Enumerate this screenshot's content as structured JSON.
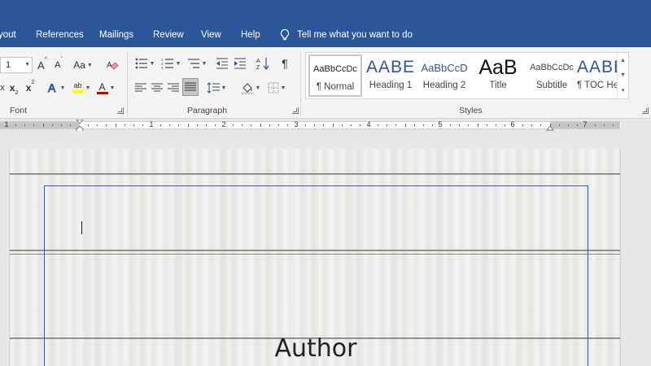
{
  "ribbon_tabs": [
    "yout",
    "References",
    "Mailings",
    "Review",
    "View",
    "Help"
  ],
  "tell_me": {
    "icon": "lightbulb-icon",
    "label": "Tell me what you want to do"
  },
  "font_group": {
    "label": "Font",
    "size_value": "1",
    "grow_label": "A",
    "shrink_label": "A",
    "case_label": "Aa",
    "subscript_label": "x",
    "superscript_label": "x",
    "highlight_label": "ab",
    "font_color_label": "A"
  },
  "paragraph_group": {
    "label": "Paragraph",
    "pilcrow": "¶"
  },
  "styles_group": {
    "label": "Styles",
    "items": [
      {
        "preview": "AaBbCcDc",
        "name": "¶ Normal"
      },
      {
        "preview": "AABE",
        "name": "Heading 1"
      },
      {
        "preview": "AaBbCcD",
        "name": "Heading 2"
      },
      {
        "preview": "AaB",
        "name": "Title"
      },
      {
        "preview": "AaBbCcDc",
        "name": "Subtitle"
      },
      {
        "preview": "AABE",
        "name": "¶ TOC He..."
      }
    ]
  },
  "ruler": {
    "numbers": [
      "1",
      "1",
      "2",
      "3",
      "4",
      "5",
      "6",
      "7"
    ]
  },
  "document": {
    "author_text": "Author"
  },
  "colors": {
    "ribbon_blue": "#2b579a",
    "heading_blue": "#2f5597",
    "frame_blue": "#3a5ea8",
    "font_red": "#c00000",
    "highlight_yellow": "#ffff00"
  }
}
